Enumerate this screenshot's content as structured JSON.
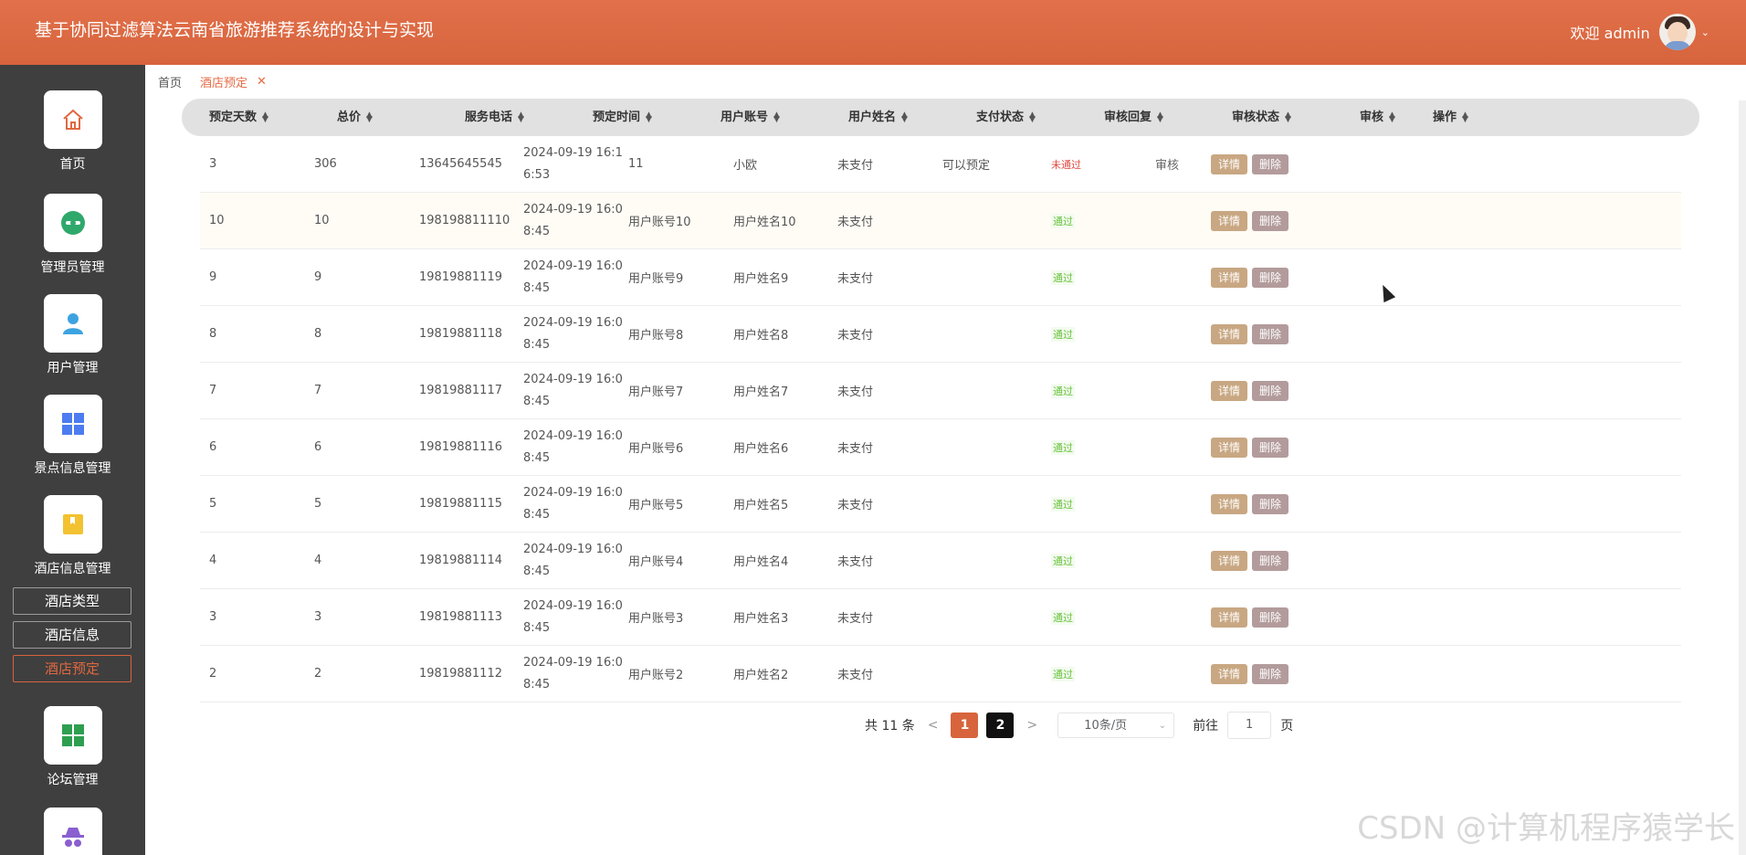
{
  "header": {
    "title": "基于协同过滤算法云南省旅游推荐系统的设计与实现",
    "welcome": "欢迎 admin",
    "chevron": "⌄"
  },
  "sidebar": {
    "items": [
      {
        "label": "首页",
        "icon": "home-icon"
      },
      {
        "label": "管理员管理",
        "icon": "admin-icon"
      },
      {
        "label": "用户管理",
        "icon": "user-icon"
      },
      {
        "label": "景点信息管理",
        "icon": "grid-icon"
      },
      {
        "label": "酒店信息管理",
        "icon": "bookmark-icon"
      },
      {
        "label": "论坛管理",
        "icon": "forum-icon"
      }
    ],
    "subitems": [
      {
        "label": "酒店类型"
      },
      {
        "label": "酒店信息"
      },
      {
        "label": "酒店预定"
      }
    ]
  },
  "tags": {
    "home": "首页",
    "active": "酒店预定",
    "close": "✕"
  },
  "table": {
    "headers": [
      "预定天数",
      "总价",
      "服务电话",
      "预定时间",
      "用户账号",
      "用户姓名",
      "支付状态",
      "审核回复",
      "审核状态",
      "审核",
      "操作"
    ],
    "rows": [
      {
        "days": "3",
        "price": "306",
        "phone": "13645645545",
        "time": "2024-09-19 16:16:53",
        "account": "11",
        "name": "小欧",
        "pay": "未支付",
        "reply": "可以预定",
        "status": "未通过",
        "audit": "审核"
      },
      {
        "days": "10",
        "price": "10",
        "phone": "198198811110",
        "time": "2024-09-19 16:08:45",
        "account": "用户账号10",
        "name": "用户姓名10",
        "pay": "未支付",
        "reply": "",
        "status": "通过",
        "audit": ""
      },
      {
        "days": "9",
        "price": "9",
        "phone": "19819881119",
        "time": "2024-09-19 16:08:45",
        "account": "用户账号9",
        "name": "用户姓名9",
        "pay": "未支付",
        "reply": "",
        "status": "通过",
        "audit": ""
      },
      {
        "days": "8",
        "price": "8",
        "phone": "19819881118",
        "time": "2024-09-19 16:08:45",
        "account": "用户账号8",
        "name": "用户姓名8",
        "pay": "未支付",
        "reply": "",
        "status": "通过",
        "audit": ""
      },
      {
        "days": "7",
        "price": "7",
        "phone": "19819881117",
        "time": "2024-09-19 16:08:45",
        "account": "用户账号7",
        "name": "用户姓名7",
        "pay": "未支付",
        "reply": "",
        "status": "通过",
        "audit": ""
      },
      {
        "days": "6",
        "price": "6",
        "phone": "19819881116",
        "time": "2024-09-19 16:08:45",
        "account": "用户账号6",
        "name": "用户姓名6",
        "pay": "未支付",
        "reply": "",
        "status": "通过",
        "audit": ""
      },
      {
        "days": "5",
        "price": "5",
        "phone": "19819881115",
        "time": "2024-09-19 16:08:45",
        "account": "用户账号5",
        "name": "用户姓名5",
        "pay": "未支付",
        "reply": "",
        "status": "通过",
        "audit": ""
      },
      {
        "days": "4",
        "price": "4",
        "phone": "19819881114",
        "time": "2024-09-19 16:08:45",
        "account": "用户账号4",
        "name": "用户姓名4",
        "pay": "未支付",
        "reply": "",
        "status": "通过",
        "audit": ""
      },
      {
        "days": "3",
        "price": "3",
        "phone": "19819881113",
        "time": "2024-09-19 16:08:45",
        "account": "用户账号3",
        "name": "用户姓名3",
        "pay": "未支付",
        "reply": "",
        "status": "通过",
        "audit": ""
      },
      {
        "days": "2",
        "price": "2",
        "phone": "19819881112",
        "time": "2024-09-19 16:08:45",
        "account": "用户账号2",
        "name": "用户姓名2",
        "pay": "未支付",
        "reply": "",
        "status": "通过",
        "audit": ""
      }
    ],
    "actions": {
      "detail": "详情",
      "delete": "删除"
    }
  },
  "pagination": {
    "total": "共 11 条",
    "prev": "<",
    "next": ">",
    "pages": [
      "1",
      "2"
    ],
    "page_size": "10条/页",
    "goto_label": "前往",
    "goto_value": "1",
    "page_suffix": "页"
  },
  "watermark": "CSDN @计算机程序猿学长",
  "colors": {
    "accent": "#d7643d",
    "pass": "#67c23a",
    "fail": "#e0483f",
    "sidebar": "#3f3f3f"
  }
}
